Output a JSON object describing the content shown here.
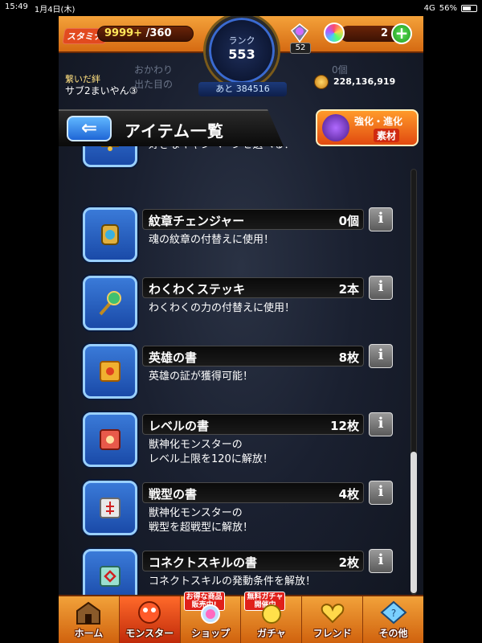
{
  "status_bar": {
    "time": "15:49",
    "date": "1月4日(木)",
    "network": "4G",
    "battery": "56%"
  },
  "hud": {
    "stamina_label": "スタミナ",
    "stamina_current": "9999+",
    "stamina_max": "/360",
    "rank_label": "ランク",
    "rank_value": "553",
    "rank_next": "あと 384516",
    "gem_count": "52",
    "orb_count": "2",
    "plus_label": "+",
    "bond_label": "繋いだ絆",
    "bond_value": "サブ2まいやん③",
    "ghost_line1": "おかわり",
    "ghost_line2": "出た目の",
    "ghost_count": "0個",
    "gold": "228,136,919"
  },
  "header": {
    "back_label": "⇐",
    "title": "アイテム一覧",
    "material_line1": "強化・進化",
    "material_line2": "素材"
  },
  "items": [
    {
      "name": "",
      "count": "",
      "desc": "好きなキャンペーンを選べる！",
      "color": "#3a7ad8"
    },
    {
      "name": "紋章チェンジャー",
      "count": "0個",
      "desc": "魂の紋章の付替えに使用！",
      "color": "#3a7ad8"
    },
    {
      "name": "わくわくステッキ",
      "count": "2本",
      "desc": "わくわくの力の付替えに使用！",
      "color": "#3a7ad8"
    },
    {
      "name": "英雄の書",
      "count": "8枚",
      "desc": "英雄の証が獲得可能！",
      "color": "#3a7ad8"
    },
    {
      "name": "レベルの書",
      "count": "12枚",
      "desc": "獣神化モンスターの\nレベル上限を120に解放！",
      "color": "#3a7ad8"
    },
    {
      "name": "戦型の書",
      "count": "4枚",
      "desc": "獣神化モンスターの\n戦型を超戦型に解放！",
      "color": "#3a7ad8"
    },
    {
      "name": "コネクトスキルの書",
      "count": "2枚",
      "desc": "コネクトスキルの発動条件を解放！",
      "color": "#3a7ad8"
    }
  ],
  "info_label": "i",
  "nav": {
    "home": "ホーム",
    "monster": "モンスター",
    "shop": "ショップ",
    "shop_badge": "お得な商品\n販売中!",
    "gacha": "ガチャ",
    "gacha_badge": "無料ガチャ\n開催中",
    "friend": "フレンド",
    "other": "その他"
  }
}
